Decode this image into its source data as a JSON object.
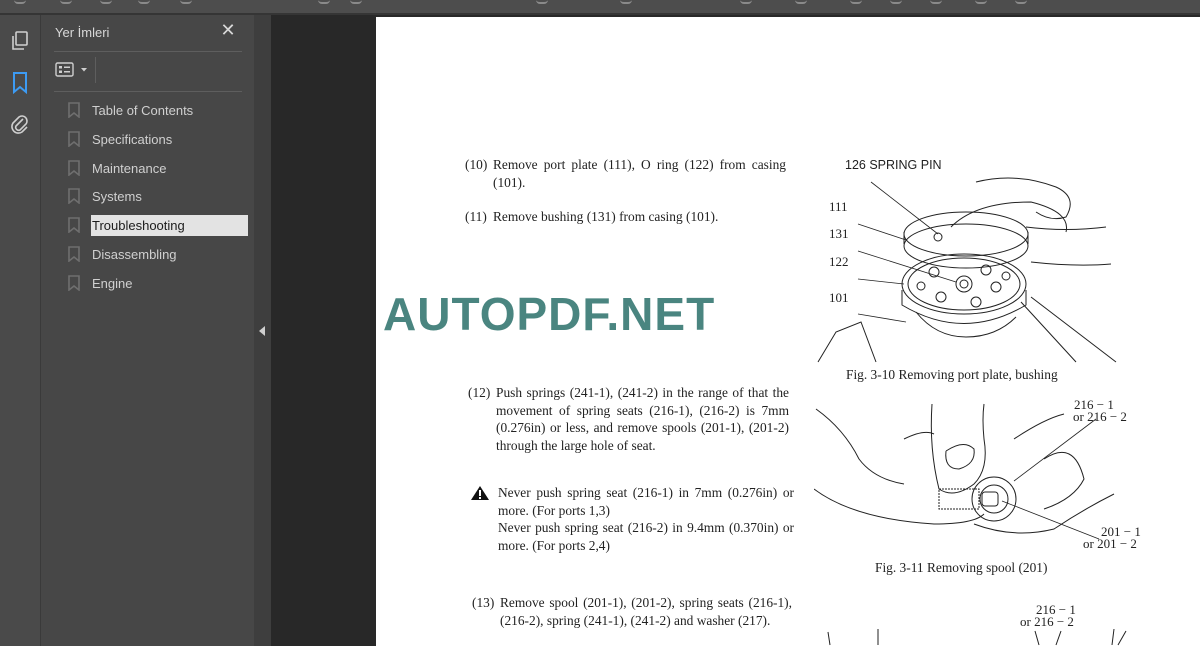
{
  "toolbar": {},
  "left_rail": {
    "icons": [
      "pages-icon",
      "bookmark-icon",
      "attachment-icon"
    ],
    "active": "bookmark-icon",
    "accent_color": "#3d9bf3"
  },
  "bookmarks_panel": {
    "title": "Yer İmleri",
    "close_label": "✕",
    "options_icon": "list-options-icon",
    "items": [
      {
        "label": "Table of Contents",
        "selected": false
      },
      {
        "label": "Specifications",
        "selected": false
      },
      {
        "label": "Maintenance",
        "selected": false
      },
      {
        "label": "Systems",
        "selected": false
      },
      {
        "label": "Troubleshooting",
        "selected": true
      },
      {
        "label": "Disassembling",
        "selected": false
      },
      {
        "label": "Engine",
        "selected": false
      }
    ]
  },
  "document": {
    "watermark": "AUTOPDF.NET",
    "watermark_color": "#4a8580",
    "steps": [
      {
        "num": "(10)",
        "text": "Remove port plate (111), O ring (122) from casing (101)."
      },
      {
        "num": "(11)",
        "text": "Remove bushing (131) from casing (101)."
      },
      {
        "num": "(12)",
        "text": "Push springs (241-1), (241-2) in the range of that the movement of spring seats (216-1), (216-2) is 7mm (0.276in) or less, and remove spools (201-1), (201-2) through the large hole of seat."
      },
      {
        "num": "(13)",
        "text": "Remove spool (201-1), (201-2), spring seats (216-1), (216-2), spring (241-1), (241-2) and washer (217)."
      }
    ],
    "warning": {
      "icon": "warning-icon",
      "line1": "Never push spring seat (216-1) in 7mm (0.276in) or more. (For ports 1,3)",
      "line2": "Never push spring seat (216-2) in 9.4mm (0.370in) or more. (For ports 2,4)"
    },
    "fig1": {
      "labels": {
        "spring_pin": "126    SPRING PIN",
        "l111": "111",
        "l131": "131",
        "l122": "122",
        "l101": "101"
      },
      "caption": "Fig. 3-10    Removing port plate, bushing"
    },
    "fig2": {
      "labels": {
        "seat_a": "216 − 1",
        "seat_b": "or 216 − 2",
        "spool_a": "201 − 1",
        "spool_b": "or  201 − 2"
      },
      "caption": "Fig. 3-11    Removing spool (201)"
    },
    "fig3": {
      "labels": {
        "seat_a": "216 − 1",
        "seat_b": "or 216 − 2"
      }
    }
  }
}
